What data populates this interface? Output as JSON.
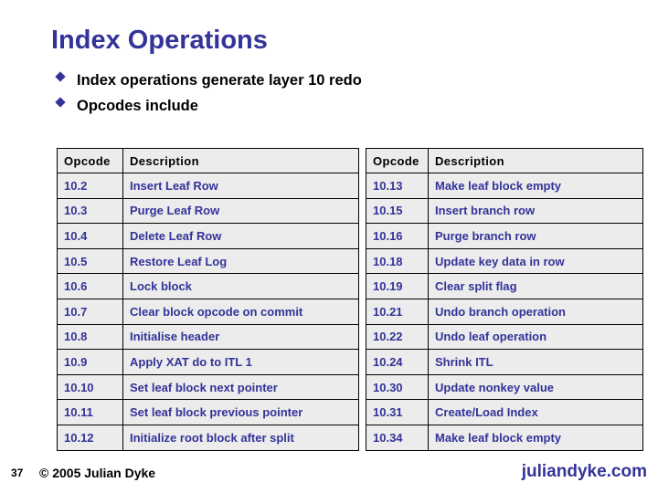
{
  "slide": {
    "title": "Index Operations",
    "bullets": [
      {
        "marker": "diamond-bullet-icon",
        "text": "Index operations generate layer 10 redo"
      },
      {
        "marker": "diamond-bullet-icon",
        "text": "Opcodes include"
      }
    ]
  },
  "tables": {
    "headers": {
      "opcode": "Opcode",
      "description": "Description"
    },
    "left_rows": [
      {
        "opcode": "10.2",
        "description": "Insert Leaf Row"
      },
      {
        "opcode": "10.3",
        "description": "Purge Leaf Row"
      },
      {
        "opcode": "10.4",
        "description": "Delete Leaf Row"
      },
      {
        "opcode": "10.5",
        "description": "Restore Leaf Log"
      },
      {
        "opcode": "10.6",
        "description": "Lock block"
      },
      {
        "opcode": "10.7",
        "description": "Clear block opcode on commit"
      },
      {
        "opcode": "10.8",
        "description": "Initialise header"
      },
      {
        "opcode": "10.9",
        "description": "Apply XAT do to ITL 1"
      },
      {
        "opcode": "10.10",
        "description": "Set leaf block next pointer"
      },
      {
        "opcode": "10.11",
        "description": "Set leaf block previous pointer"
      },
      {
        "opcode": "10.12",
        "description": "Initialize root block after split"
      }
    ],
    "right_rows": [
      {
        "opcode": "10.13",
        "description": "Make leaf block empty"
      },
      {
        "opcode": "10.15",
        "description": "Insert branch row"
      },
      {
        "opcode": "10.16",
        "description": "Purge branch row"
      },
      {
        "opcode": "10.18",
        "description": "Update key data in row"
      },
      {
        "opcode": "10.19",
        "description": "Clear split flag"
      },
      {
        "opcode": "10.21",
        "description": "Undo branch operation"
      },
      {
        "opcode": "10.22",
        "description": "Undo leaf operation"
      },
      {
        "opcode": "10.24",
        "description": "Shrink ITL"
      },
      {
        "opcode": "10.30",
        "description": "Update nonkey value"
      },
      {
        "opcode": "10.31",
        "description": "Create/Load Index"
      },
      {
        "opcode": "10.34",
        "description": "Make leaf block empty"
      }
    ]
  },
  "footer": {
    "page_number": "37",
    "copyright": "© 2005 Julian Dyke",
    "brand": "juliandyke.com"
  },
  "colors": {
    "accent_blue": "#333399",
    "table_fill": "#ececec",
    "text_black": "#000000",
    "background": "#ffffff"
  }
}
